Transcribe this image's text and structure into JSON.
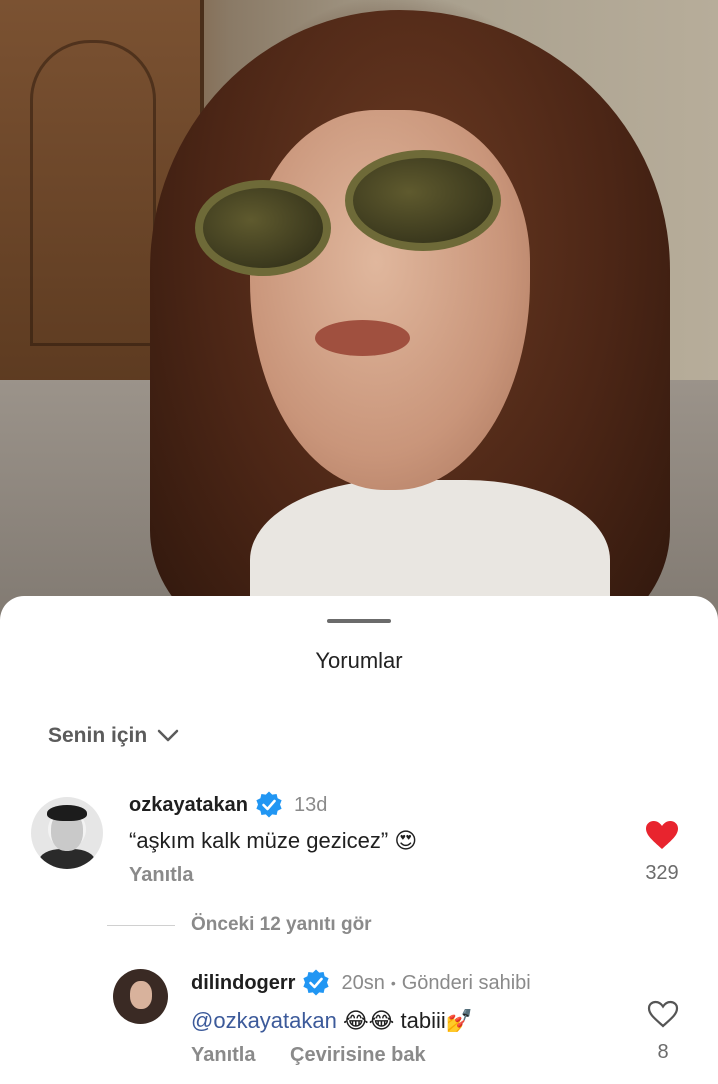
{
  "sheet": {
    "title": "Yorumlar",
    "filter_label": "Senin için"
  },
  "comments": [
    {
      "username": "ozkayatakan",
      "verified": true,
      "time": "13d",
      "text": "“aşkım kalk müze gezicez” 😍",
      "reply_label": "Yanıtla",
      "likes": "329",
      "liked": true,
      "like_color": "#e8242e"
    }
  ],
  "view_more_replies": "Önceki 12 yanıtı gör",
  "reply": {
    "username": "dilindogerr",
    "verified": true,
    "time": "20sn",
    "separator": "•",
    "owner_label": "Gönderi sahibi",
    "mention": "@ozkayatakan",
    "text": " 😂😂 tabiii💅",
    "reply_label": "Yanıtla",
    "translate_label": "Çevirisine bak",
    "likes": "8",
    "liked": false
  },
  "colors": {
    "verified_badge": "#2196f3",
    "mention": "#3c5a9a"
  },
  "icons": {
    "verified": "verified-badge-icon",
    "like_filled": "heart-filled-icon",
    "like_outline": "heart-outline-icon",
    "chevron": "chevron-down-icon"
  }
}
